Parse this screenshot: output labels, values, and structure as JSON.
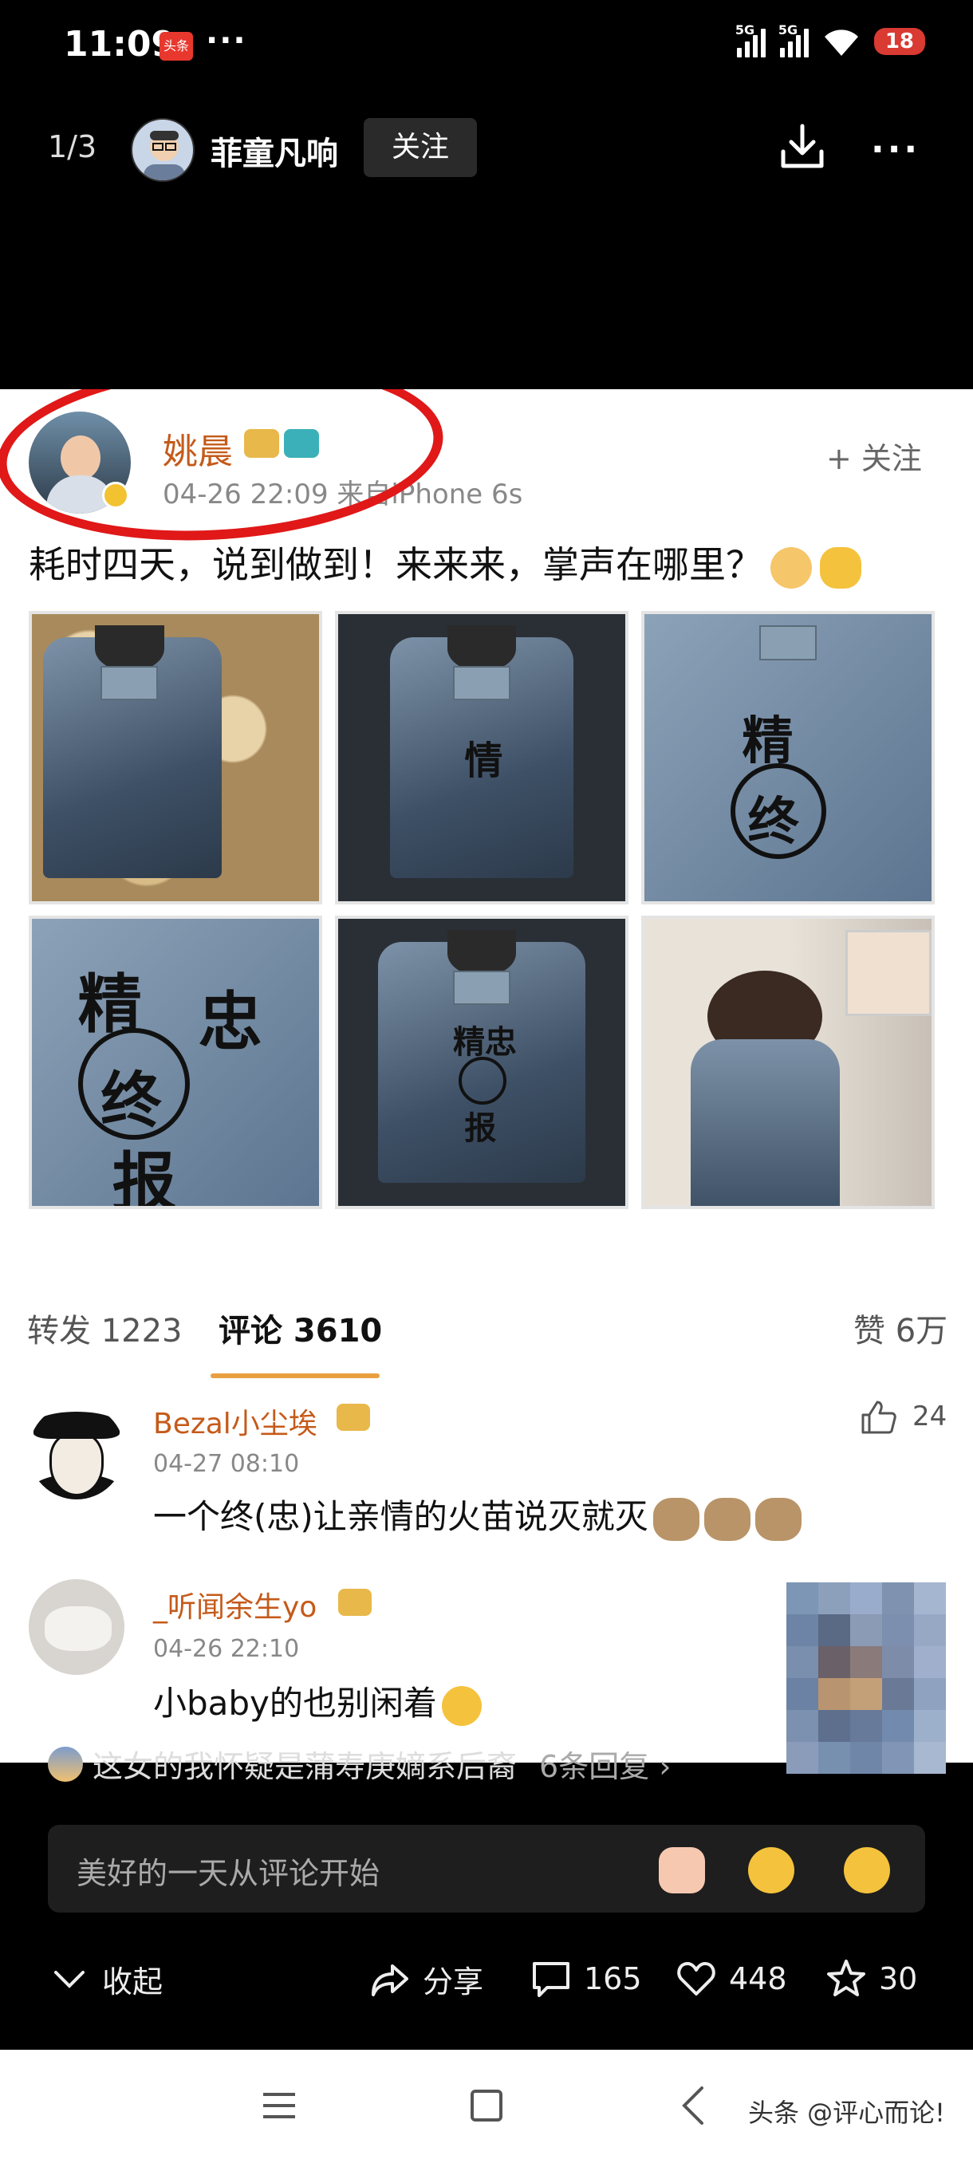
{
  "status_bar": {
    "time": "11:09",
    "app_badge": "头条",
    "more": "···",
    "signal1_label": "5G",
    "signal2_label": "5G",
    "battery": "18"
  },
  "top_nav": {
    "page_count": "1/3",
    "author_name": "菲童凡响",
    "follow_label": "关注",
    "download_icon": "download-icon",
    "more_icon": "more-icon"
  },
  "weibo_post": {
    "user_name": "姚晨",
    "time_source": "04-26 22:09  来自iPhone 6s",
    "follow_label": "+ 关注",
    "text": "耗时四天，说到做到！来来来，掌声在哪里？",
    "tabs": {
      "repost": "转发 1223",
      "comments": "评论 3610",
      "likes": "赞 6万"
    }
  },
  "comments": [
    {
      "name": "Bezal小尘埃",
      "time": "04-27 08:10",
      "text": "一个终(忠)让亲情的火苗说灭就灭",
      "likes": "24"
    },
    {
      "name": "_听闻余生yo",
      "time": "04-26 22:10",
      "text": "小baby的也别闲着"
    }
  ],
  "reply_line": {
    "text": "这女的我怀疑是蒲寿庚嫡系后裔",
    "count": "6条回复 ›"
  },
  "comment_input": {
    "placeholder": "美好的一天从评论开始"
  },
  "action_bar": {
    "collapse": "收起",
    "share": "分享",
    "comments": "165",
    "likes": "448",
    "favorites": "30"
  },
  "watermark": "头条 @评心而论!",
  "colors": {
    "accent_red": "#e01818",
    "name_orange": "#c55a1a",
    "tab_underline": "#e8a040"
  }
}
